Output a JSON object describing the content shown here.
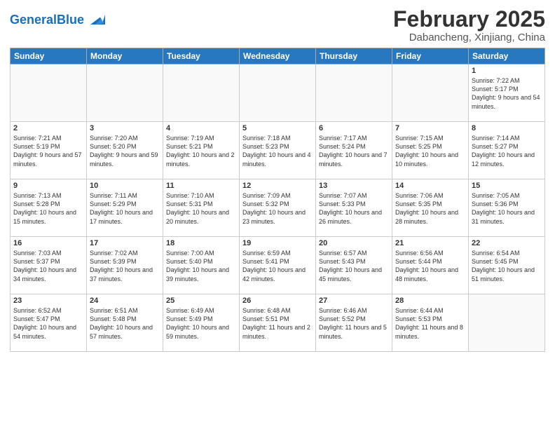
{
  "header": {
    "logo_general": "General",
    "logo_blue": "Blue",
    "title": "February 2025",
    "subtitle": "Dabancheng, Xinjiang, China"
  },
  "weekdays": [
    "Sunday",
    "Monday",
    "Tuesday",
    "Wednesday",
    "Thursday",
    "Friday",
    "Saturday"
  ],
  "weeks": [
    [
      {
        "day": null
      },
      {
        "day": null
      },
      {
        "day": null
      },
      {
        "day": null
      },
      {
        "day": null
      },
      {
        "day": null
      },
      {
        "day": "1",
        "sunrise": "7:22 AM",
        "sunset": "5:17 PM",
        "daylight": "9 hours and 54 minutes."
      }
    ],
    [
      {
        "day": "2",
        "sunrise": "7:21 AM",
        "sunset": "5:19 PM",
        "daylight": "9 hours and 57 minutes."
      },
      {
        "day": "3",
        "sunrise": "7:20 AM",
        "sunset": "5:20 PM",
        "daylight": "9 hours and 59 minutes."
      },
      {
        "day": "4",
        "sunrise": "7:19 AM",
        "sunset": "5:21 PM",
        "daylight": "10 hours and 2 minutes."
      },
      {
        "day": "5",
        "sunrise": "7:18 AM",
        "sunset": "5:23 PM",
        "daylight": "10 hours and 4 minutes."
      },
      {
        "day": "6",
        "sunrise": "7:17 AM",
        "sunset": "5:24 PM",
        "daylight": "10 hours and 7 minutes."
      },
      {
        "day": "7",
        "sunrise": "7:15 AM",
        "sunset": "5:25 PM",
        "daylight": "10 hours and 10 minutes."
      },
      {
        "day": "8",
        "sunrise": "7:14 AM",
        "sunset": "5:27 PM",
        "daylight": "10 hours and 12 minutes."
      }
    ],
    [
      {
        "day": "9",
        "sunrise": "7:13 AM",
        "sunset": "5:28 PM",
        "daylight": "10 hours and 15 minutes."
      },
      {
        "day": "10",
        "sunrise": "7:11 AM",
        "sunset": "5:29 PM",
        "daylight": "10 hours and 17 minutes."
      },
      {
        "day": "11",
        "sunrise": "7:10 AM",
        "sunset": "5:31 PM",
        "daylight": "10 hours and 20 minutes."
      },
      {
        "day": "12",
        "sunrise": "7:09 AM",
        "sunset": "5:32 PM",
        "daylight": "10 hours and 23 minutes."
      },
      {
        "day": "13",
        "sunrise": "7:07 AM",
        "sunset": "5:33 PM",
        "daylight": "10 hours and 26 minutes."
      },
      {
        "day": "14",
        "sunrise": "7:06 AM",
        "sunset": "5:35 PM",
        "daylight": "10 hours and 28 minutes."
      },
      {
        "day": "15",
        "sunrise": "7:05 AM",
        "sunset": "5:36 PM",
        "daylight": "10 hours and 31 minutes."
      }
    ],
    [
      {
        "day": "16",
        "sunrise": "7:03 AM",
        "sunset": "5:37 PM",
        "daylight": "10 hours and 34 minutes."
      },
      {
        "day": "17",
        "sunrise": "7:02 AM",
        "sunset": "5:39 PM",
        "daylight": "10 hours and 37 minutes."
      },
      {
        "day": "18",
        "sunrise": "7:00 AM",
        "sunset": "5:40 PM",
        "daylight": "10 hours and 39 minutes."
      },
      {
        "day": "19",
        "sunrise": "6:59 AM",
        "sunset": "5:41 PM",
        "daylight": "10 hours and 42 minutes."
      },
      {
        "day": "20",
        "sunrise": "6:57 AM",
        "sunset": "5:43 PM",
        "daylight": "10 hours and 45 minutes."
      },
      {
        "day": "21",
        "sunrise": "6:56 AM",
        "sunset": "5:44 PM",
        "daylight": "10 hours and 48 minutes."
      },
      {
        "day": "22",
        "sunrise": "6:54 AM",
        "sunset": "5:45 PM",
        "daylight": "10 hours and 51 minutes."
      }
    ],
    [
      {
        "day": "23",
        "sunrise": "6:52 AM",
        "sunset": "5:47 PM",
        "daylight": "10 hours and 54 minutes."
      },
      {
        "day": "24",
        "sunrise": "6:51 AM",
        "sunset": "5:48 PM",
        "daylight": "10 hours and 57 minutes."
      },
      {
        "day": "25",
        "sunrise": "6:49 AM",
        "sunset": "5:49 PM",
        "daylight": "10 hours and 59 minutes."
      },
      {
        "day": "26",
        "sunrise": "6:48 AM",
        "sunset": "5:51 PM",
        "daylight": "11 hours and 2 minutes."
      },
      {
        "day": "27",
        "sunrise": "6:46 AM",
        "sunset": "5:52 PM",
        "daylight": "11 hours and 5 minutes."
      },
      {
        "day": "28",
        "sunrise": "6:44 AM",
        "sunset": "5:53 PM",
        "daylight": "11 hours and 8 minutes."
      },
      {
        "day": null
      }
    ]
  ]
}
